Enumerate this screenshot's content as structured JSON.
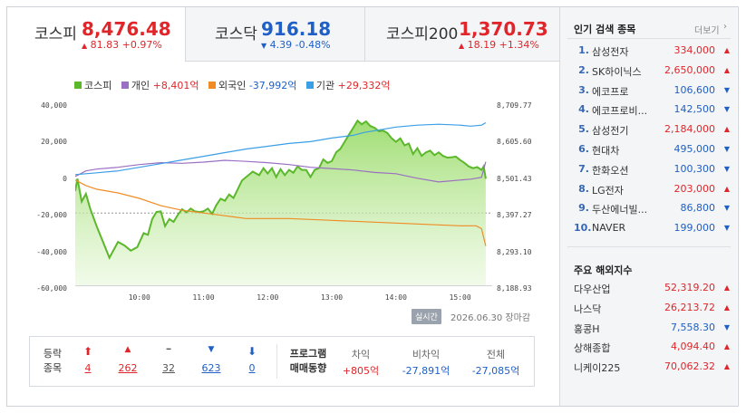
{
  "indices": [
    {
      "name": "코스피",
      "value": "8,476.48",
      "arrow": "▲",
      "change": "81.83",
      "pct": "+0.97%",
      "dir": "up"
    },
    {
      "name": "코스닥",
      "value": "916.18",
      "arrow": "▼",
      "change": "4.39",
      "pct": "-0.48%",
      "dir": "down"
    },
    {
      "name": "코스피200",
      "value": "1,370.73",
      "arrow": "▲",
      "change": "18.19",
      "pct": "+1.34%",
      "dir": "up"
    }
  ],
  "legend": [
    {
      "label": "코스피",
      "value": "",
      "color": "#5cb82b"
    },
    {
      "label": "개인",
      "value": "+8,401억",
      "color": "#9b6fc3",
      "valueColor": "#e0262a"
    },
    {
      "label": "외국인",
      "value": "-37,992억",
      "color": "#f08c25",
      "valueColor": "#1f5fc6"
    },
    {
      "label": "기관",
      "value": "+29,332억",
      "color": "#3b9fe6",
      "valueColor": "#e0262a"
    }
  ],
  "chart_data": {
    "type": "line",
    "title": "",
    "x_ticks": [
      "10:00",
      "11:00",
      "12:00",
      "13:00",
      "14:00",
      "15:00"
    ],
    "x_range_minutes": [
      540,
      930
    ],
    "y_left_ticks": [
      "40,000",
      "20,000",
      "0",
      "-20,000",
      "-40,000",
      "-60,000"
    ],
    "y_left_range": [
      -60000,
      40000
    ],
    "y_right_ticks": [
      "8,709.77",
      "8,605.60",
      "8,501.43",
      "8,397.27",
      "8,293.10",
      "8,188.93"
    ],
    "y_right_range": [
      8188.93,
      8709.77
    ],
    "reference_level_left": -20000,
    "series": [
      {
        "name": "코스피",
        "axis": "right",
        "color": "#5cb82b",
        "fill": true,
        "points": [
          [
            540,
            8460
          ],
          [
            542,
            8495
          ],
          [
            546,
            8430
          ],
          [
            550,
            8452
          ],
          [
            554,
            8410
          ],
          [
            560,
            8360
          ],
          [
            568,
            8300
          ],
          [
            572,
            8270
          ],
          [
            580,
            8315
          ],
          [
            586,
            8305
          ],
          [
            592,
            8290
          ],
          [
            598,
            8300
          ],
          [
            604,
            8340
          ],
          [
            608,
            8335
          ],
          [
            612,
            8380
          ],
          [
            616,
            8400
          ],
          [
            620,
            8402
          ],
          [
            624,
            8360
          ],
          [
            628,
            8380
          ],
          [
            632,
            8372
          ],
          [
            636,
            8392
          ],
          [
            640,
            8408
          ],
          [
            644,
            8399
          ],
          [
            648,
            8410
          ],
          [
            652,
            8402
          ],
          [
            656,
            8400
          ],
          [
            660,
            8402
          ],
          [
            664,
            8410
          ],
          [
            668,
            8395
          ],
          [
            672,
            8420
          ],
          [
            676,
            8438
          ],
          [
            680,
            8432
          ],
          [
            684,
            8450
          ],
          [
            688,
            8440
          ],
          [
            692,
            8465
          ],
          [
            696,
            8490
          ],
          [
            700,
            8500
          ],
          [
            706,
            8515
          ],
          [
            712,
            8505
          ],
          [
            716,
            8525
          ],
          [
            720,
            8510
          ],
          [
            724,
            8525
          ],
          [
            728,
            8500
          ],
          [
            732,
            8522
          ],
          [
            736,
            8505
          ],
          [
            740,
            8520
          ],
          [
            744,
            8512
          ],
          [
            748,
            8530
          ],
          [
            752,
            8520
          ],
          [
            756,
            8520
          ],
          [
            760,
            8500
          ],
          [
            764,
            8520
          ],
          [
            768,
            8525
          ],
          [
            772,
            8550
          ],
          [
            776,
            8540
          ],
          [
            780,
            8545
          ],
          [
            784,
            8570
          ],
          [
            788,
            8580
          ],
          [
            792,
            8600
          ],
          [
            796,
            8620
          ],
          [
            800,
            8640
          ],
          [
            804,
            8660
          ],
          [
            808,
            8650
          ],
          [
            812,
            8658
          ],
          [
            816,
            8645
          ],
          [
            820,
            8640
          ],
          [
            824,
            8630
          ],
          [
            828,
            8632
          ],
          [
            832,
            8625
          ],
          [
            836,
            8610
          ],
          [
            840,
            8600
          ],
          [
            844,
            8610
          ],
          [
            848,
            8590
          ],
          [
            852,
            8595
          ],
          [
            856,
            8565
          ],
          [
            860,
            8582
          ],
          [
            864,
            8560
          ],
          [
            868,
            8570
          ],
          [
            872,
            8575
          ],
          [
            876,
            8562
          ],
          [
            880,
            8570
          ],
          [
            884,
            8560
          ],
          [
            888,
            8555
          ],
          [
            892,
            8556
          ],
          [
            896,
            8558
          ],
          [
            900,
            8548
          ],
          [
            904,
            8540
          ],
          [
            908,
            8530
          ],
          [
            912,
            8525
          ],
          [
            916,
            8528
          ],
          [
            920,
            8520
          ],
          [
            922,
            8530
          ],
          [
            924,
            8495
          ]
        ]
      },
      {
        "name": "개인",
        "axis": "left",
        "value": "+8,401억",
        "color": "#9b6fc3",
        "points": [
          [
            540,
            0
          ],
          [
            550,
            3000
          ],
          [
            560,
            4000
          ],
          [
            580,
            5000
          ],
          [
            600,
            6500
          ],
          [
            620,
            7500
          ],
          [
            640,
            7200
          ],
          [
            660,
            7800
          ],
          [
            680,
            8800
          ],
          [
            700,
            8200
          ],
          [
            720,
            7500
          ],
          [
            740,
            6500
          ],
          [
            760,
            5000
          ],
          [
            780,
            4300
          ],
          [
            800,
            3500
          ],
          [
            820,
            2200
          ],
          [
            840,
            1500
          ],
          [
            860,
            -1000
          ],
          [
            880,
            -3000
          ],
          [
            900,
            -2000
          ],
          [
            910,
            -1500
          ],
          [
            920,
            -500
          ],
          [
            924,
            8000
          ]
        ]
      },
      {
        "name": "외국인",
        "axis": "left",
        "value": "-37,992억",
        "color": "#f08c25",
        "points": [
          [
            540,
            -2000
          ],
          [
            550,
            -5000
          ],
          [
            560,
            -7000
          ],
          [
            580,
            -9000
          ],
          [
            600,
            -12000
          ],
          [
            620,
            -16000
          ],
          [
            640,
            -18500
          ],
          [
            660,
            -20000
          ],
          [
            680,
            -21500
          ],
          [
            700,
            -23000
          ],
          [
            720,
            -23000
          ],
          [
            740,
            -23000
          ],
          [
            760,
            -23500
          ],
          [
            780,
            -24000
          ],
          [
            800,
            -24500
          ],
          [
            820,
            -25000
          ],
          [
            840,
            -25500
          ],
          [
            860,
            -26000
          ],
          [
            880,
            -26500
          ],
          [
            900,
            -27000
          ],
          [
            915,
            -27000
          ],
          [
            920,
            -28500
          ],
          [
            924,
            -38000
          ]
        ]
      },
      {
        "name": "기관",
        "axis": "left",
        "value": "+29,332억",
        "color": "#3b9fe6",
        "points": [
          [
            540,
            1000
          ],
          [
            550,
            1500
          ],
          [
            560,
            2000
          ],
          [
            580,
            3000
          ],
          [
            600,
            5000
          ],
          [
            620,
            7000
          ],
          [
            640,
            9000
          ],
          [
            660,
            11000
          ],
          [
            680,
            13000
          ],
          [
            700,
            15000
          ],
          [
            720,
            16500
          ],
          [
            740,
            18000
          ],
          [
            760,
            19000
          ],
          [
            780,
            21000
          ],
          [
            800,
            22500
          ],
          [
            810,
            24000
          ],
          [
            820,
            25000
          ],
          [
            840,
            27000
          ],
          [
            860,
            28000
          ],
          [
            880,
            28500
          ],
          [
            900,
            28000
          ],
          [
            910,
            27500
          ],
          [
            920,
            28000
          ],
          [
            924,
            29332
          ]
        ]
      }
    ]
  },
  "realtime_label": "실시간",
  "date_text": "2026.06.30 장마감",
  "stats": {
    "header_label1": "등락",
    "header_label2": "종목",
    "counts": [
      {
        "symbol": "⬆",
        "value": "4",
        "dir": "up"
      },
      {
        "symbol": "▲",
        "value": "262",
        "dir": "up"
      },
      {
        "symbol": "━",
        "value": "32",
        "dir": "flat"
      },
      {
        "symbol": "▼",
        "value": "623",
        "dir": "down"
      },
      {
        "symbol": "⬇",
        "value": "0",
        "dir": "down"
      }
    ],
    "program_label1": "프로그램",
    "program_label2": "매매동향",
    "program": [
      {
        "label": "차익",
        "value": "+805억",
        "dir": "up"
      },
      {
        "label": "비차익",
        "value": "-27,891억",
        "dir": "down"
      },
      {
        "label": "전체",
        "value": "-27,085억",
        "dir": "down"
      }
    ]
  },
  "popular": {
    "title": "인기 검색 종목",
    "more": "더보기",
    "items": [
      {
        "rank": "1.",
        "name": "삼성전자",
        "price": "334,000",
        "dir": "up"
      },
      {
        "rank": "2.",
        "name": "SK하이닉스",
        "price": "2,650,000",
        "dir": "up"
      },
      {
        "rank": "3.",
        "name": "에코프로",
        "price": "106,600",
        "dir": "down"
      },
      {
        "rank": "4.",
        "name": "에코프로비...",
        "price": "142,500",
        "dir": "down"
      },
      {
        "rank": "5.",
        "name": "삼성전기",
        "price": "2,184,000",
        "dir": "up"
      },
      {
        "rank": "6.",
        "name": "현대차",
        "price": "495,000",
        "dir": "down"
      },
      {
        "rank": "7.",
        "name": "한화오션",
        "price": "100,300",
        "dir": "down"
      },
      {
        "rank": "8.",
        "name": "LG전자",
        "price": "203,000",
        "dir": "up"
      },
      {
        "rank": "9.",
        "name": "두산에너빌...",
        "price": "86,800",
        "dir": "down"
      },
      {
        "rank": "10.",
        "name": "NAVER",
        "price": "199,000",
        "dir": "down"
      }
    ]
  },
  "global": {
    "title": "주요 해외지수",
    "items": [
      {
        "name": "다우산업",
        "value": "52,319.20",
        "dir": "up"
      },
      {
        "name": "나스닥",
        "value": "26,213.72",
        "dir": "up"
      },
      {
        "name": "홍콩H",
        "value": "7,558.30",
        "dir": "down"
      },
      {
        "name": "상해종합",
        "value": "4,094.40",
        "dir": "up"
      },
      {
        "name": "니케이225",
        "value": "70,062.32",
        "dir": "up"
      }
    ]
  },
  "arrows": {
    "up": "▲",
    "down": "▼"
  }
}
